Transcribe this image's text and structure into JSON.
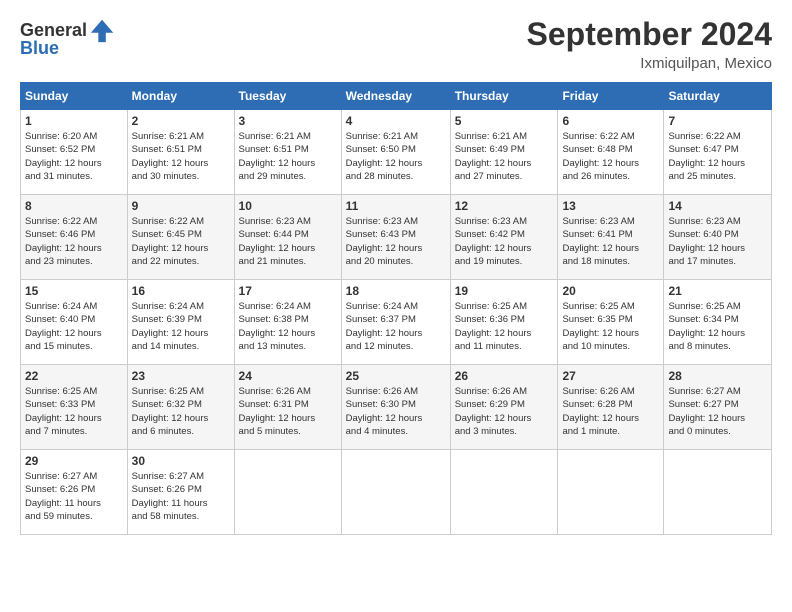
{
  "logo": {
    "general": "General",
    "blue": "Blue"
  },
  "title": "September 2024",
  "location": "Ixmiquilpan, Mexico",
  "headers": [
    "Sunday",
    "Monday",
    "Tuesday",
    "Wednesday",
    "Thursday",
    "Friday",
    "Saturday"
  ],
  "weeks": [
    [
      {
        "day": "1",
        "info": "Sunrise: 6:20 AM\nSunset: 6:52 PM\nDaylight: 12 hours\nand 31 minutes."
      },
      {
        "day": "2",
        "info": "Sunrise: 6:21 AM\nSunset: 6:51 PM\nDaylight: 12 hours\nand 30 minutes."
      },
      {
        "day": "3",
        "info": "Sunrise: 6:21 AM\nSunset: 6:51 PM\nDaylight: 12 hours\nand 29 minutes."
      },
      {
        "day": "4",
        "info": "Sunrise: 6:21 AM\nSunset: 6:50 PM\nDaylight: 12 hours\nand 28 minutes."
      },
      {
        "day": "5",
        "info": "Sunrise: 6:21 AM\nSunset: 6:49 PM\nDaylight: 12 hours\nand 27 minutes."
      },
      {
        "day": "6",
        "info": "Sunrise: 6:22 AM\nSunset: 6:48 PM\nDaylight: 12 hours\nand 26 minutes."
      },
      {
        "day": "7",
        "info": "Sunrise: 6:22 AM\nSunset: 6:47 PM\nDaylight: 12 hours\nand 25 minutes."
      }
    ],
    [
      {
        "day": "8",
        "info": "Sunrise: 6:22 AM\nSunset: 6:46 PM\nDaylight: 12 hours\nand 23 minutes."
      },
      {
        "day": "9",
        "info": "Sunrise: 6:22 AM\nSunset: 6:45 PM\nDaylight: 12 hours\nand 22 minutes."
      },
      {
        "day": "10",
        "info": "Sunrise: 6:23 AM\nSunset: 6:44 PM\nDaylight: 12 hours\nand 21 minutes."
      },
      {
        "day": "11",
        "info": "Sunrise: 6:23 AM\nSunset: 6:43 PM\nDaylight: 12 hours\nand 20 minutes."
      },
      {
        "day": "12",
        "info": "Sunrise: 6:23 AM\nSunset: 6:42 PM\nDaylight: 12 hours\nand 19 minutes."
      },
      {
        "day": "13",
        "info": "Sunrise: 6:23 AM\nSunset: 6:41 PM\nDaylight: 12 hours\nand 18 minutes."
      },
      {
        "day": "14",
        "info": "Sunrise: 6:23 AM\nSunset: 6:40 PM\nDaylight: 12 hours\nand 17 minutes."
      }
    ],
    [
      {
        "day": "15",
        "info": "Sunrise: 6:24 AM\nSunset: 6:40 PM\nDaylight: 12 hours\nand 15 minutes."
      },
      {
        "day": "16",
        "info": "Sunrise: 6:24 AM\nSunset: 6:39 PM\nDaylight: 12 hours\nand 14 minutes."
      },
      {
        "day": "17",
        "info": "Sunrise: 6:24 AM\nSunset: 6:38 PM\nDaylight: 12 hours\nand 13 minutes."
      },
      {
        "day": "18",
        "info": "Sunrise: 6:24 AM\nSunset: 6:37 PM\nDaylight: 12 hours\nand 12 minutes."
      },
      {
        "day": "19",
        "info": "Sunrise: 6:25 AM\nSunset: 6:36 PM\nDaylight: 12 hours\nand 11 minutes."
      },
      {
        "day": "20",
        "info": "Sunrise: 6:25 AM\nSunset: 6:35 PM\nDaylight: 12 hours\nand 10 minutes."
      },
      {
        "day": "21",
        "info": "Sunrise: 6:25 AM\nSunset: 6:34 PM\nDaylight: 12 hours\nand 8 minutes."
      }
    ],
    [
      {
        "day": "22",
        "info": "Sunrise: 6:25 AM\nSunset: 6:33 PM\nDaylight: 12 hours\nand 7 minutes."
      },
      {
        "day": "23",
        "info": "Sunrise: 6:25 AM\nSunset: 6:32 PM\nDaylight: 12 hours\nand 6 minutes."
      },
      {
        "day": "24",
        "info": "Sunrise: 6:26 AM\nSunset: 6:31 PM\nDaylight: 12 hours\nand 5 minutes."
      },
      {
        "day": "25",
        "info": "Sunrise: 6:26 AM\nSunset: 6:30 PM\nDaylight: 12 hours\nand 4 minutes."
      },
      {
        "day": "26",
        "info": "Sunrise: 6:26 AM\nSunset: 6:29 PM\nDaylight: 12 hours\nand 3 minutes."
      },
      {
        "day": "27",
        "info": "Sunrise: 6:26 AM\nSunset: 6:28 PM\nDaylight: 12 hours\nand 1 minute."
      },
      {
        "day": "28",
        "info": "Sunrise: 6:27 AM\nSunset: 6:27 PM\nDaylight: 12 hours\nand 0 minutes."
      }
    ],
    [
      {
        "day": "29",
        "info": "Sunrise: 6:27 AM\nSunset: 6:26 PM\nDaylight: 11 hours\nand 59 minutes."
      },
      {
        "day": "30",
        "info": "Sunrise: 6:27 AM\nSunset: 6:26 PM\nDaylight: 11 hours\nand 58 minutes."
      },
      {
        "day": "",
        "info": ""
      },
      {
        "day": "",
        "info": ""
      },
      {
        "day": "",
        "info": ""
      },
      {
        "day": "",
        "info": ""
      },
      {
        "day": "",
        "info": ""
      }
    ]
  ]
}
